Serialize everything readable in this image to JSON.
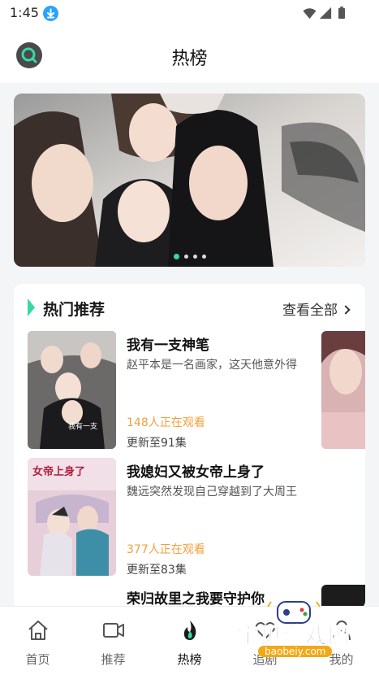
{
  "status_bar": {
    "time": "1:45"
  },
  "header": {
    "title": "热榜"
  },
  "banner": {
    "slide_count": 4,
    "active_slide": 1
  },
  "section": {
    "title": "热门推荐",
    "see_all": "查看全部",
    "items": [
      {
        "title": "我有一支神笔",
        "desc": "赵平本是一名画家，这天他意外得",
        "watching": "148人正在观看",
        "update": "更新至91集",
        "poster_text": "我有一支"
      },
      {
        "title": "我媳妇又被女帝上身了",
        "desc": "魏远突然发现自己穿越到了大周王",
        "watching": "377人正在观看",
        "update": "更新至83集",
        "poster_text": "女帝上身了"
      },
      {
        "title": "荣归故里之我要守护你"
      }
    ]
  },
  "tabbar": {
    "tabs": [
      {
        "label": "首页",
        "icon": "home-icon"
      },
      {
        "label": "推荐",
        "icon": "video-icon"
      },
      {
        "label": "热榜",
        "icon": "flame-icon",
        "active": true
      },
      {
        "label": "追剧",
        "icon": "heart-icon"
      },
      {
        "label": "我的",
        "icon": "user-icon"
      }
    ]
  },
  "watermark": {
    "text": "宝贝游戏网",
    "url": "baobeiy.com"
  },
  "colors": {
    "accent": "#36d9a6",
    "orange": "#f2a03d",
    "download": "#2aa3ff"
  }
}
